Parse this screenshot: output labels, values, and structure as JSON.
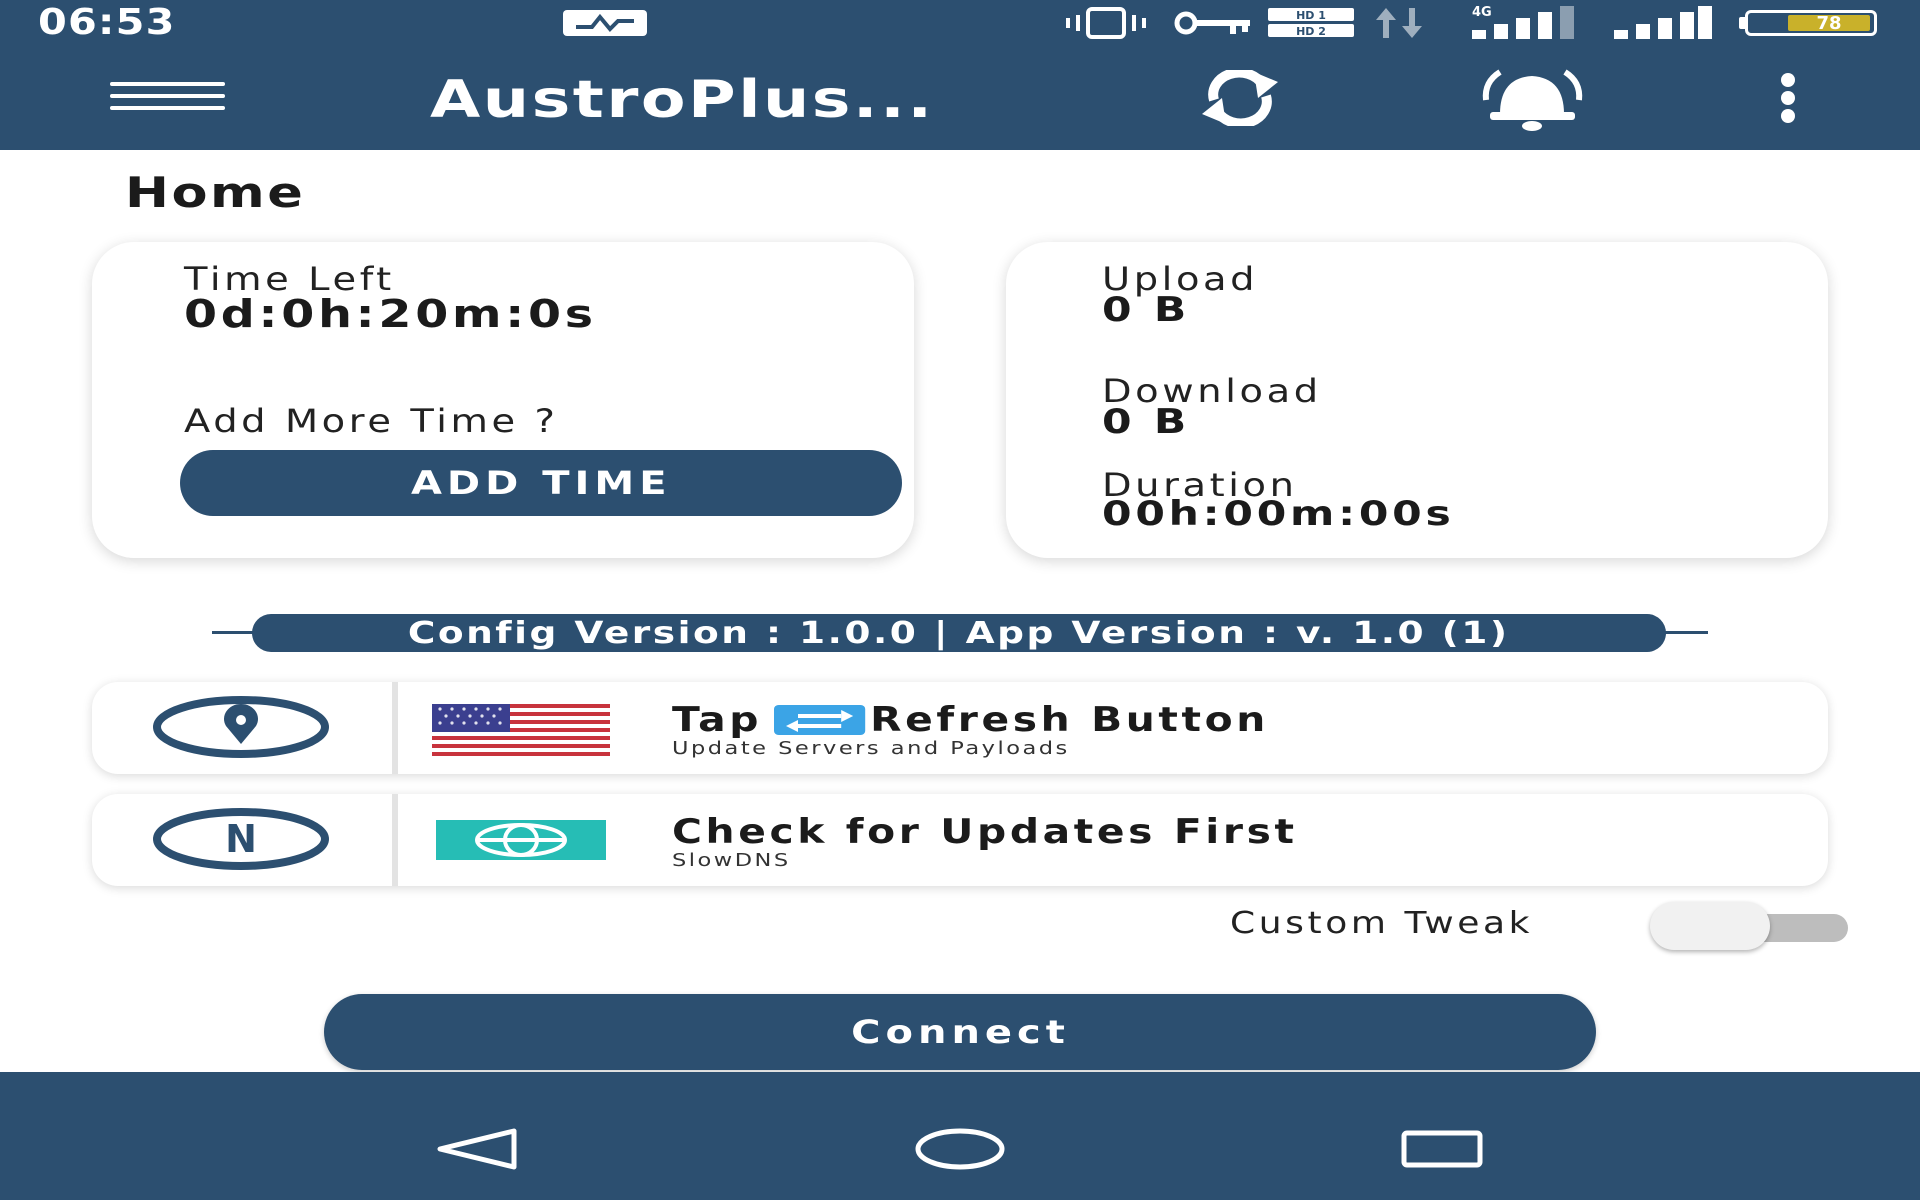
{
  "status_bar": {
    "time": "06:53",
    "network_type": "4G",
    "battery_level": "78",
    "icons": [
      "activity-icon",
      "vibrate-icon",
      "vpn-key-icon",
      "hd-icon",
      "data-arrows-icon",
      "signal-4g-icon",
      "signal-icon"
    ]
  },
  "app_bar": {
    "title": "AustroPlus...",
    "icons": [
      "menu-icon",
      "refresh-icon",
      "bell-icon",
      "more-vert-icon"
    ]
  },
  "home": {
    "page_title": "Home",
    "time_card": {
      "time_left_label": "Time Left",
      "time_left_value": "0d:0h:20m:0s",
      "add_more_label": "Add More Time ?",
      "add_time_button": "ADD TIME"
    },
    "stats_card": {
      "upload_label": "Upload",
      "upload_value": "0 B",
      "download_label": "Download",
      "download_value": "0 B",
      "duration_label": "Duration",
      "duration_value": "00h:00m:00s"
    },
    "version_text": "Config Version : 1.0.0 | App Version : v. 1.0 (1)",
    "server_row": {
      "title_prefix": "Tap",
      "title_suffix": "Refresh Button",
      "subtitle": "Update Servers and Payloads",
      "icon": "location-pin-icon",
      "flag": "us-flag-icon"
    },
    "network_row": {
      "title": "Check for Updates First",
      "subtitle": "SlowDNS",
      "icon": "n-badge-icon",
      "badge": "globe-icon"
    },
    "custom_tweak": {
      "label": "Custom Tweak",
      "enabled": false
    },
    "connect_button": "Connect"
  },
  "colors": {
    "primary": "#2c4f70",
    "surface": "#ffffff",
    "globe_badge": "#26bdb5",
    "refresh_badge": "#3ba4e6",
    "battery": "#c9b12a"
  },
  "nav_bar": {
    "icons": [
      "back-icon",
      "home-icon",
      "recents-icon"
    ]
  }
}
